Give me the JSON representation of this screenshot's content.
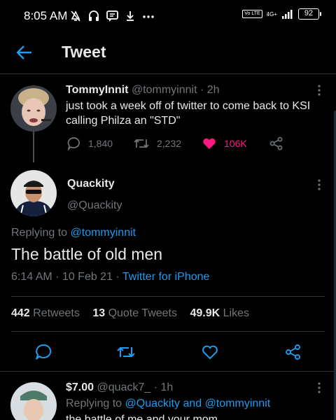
{
  "status_bar": {
    "time": "8:05 AM",
    "icons": [
      "alarm-off-icon",
      "headset-icon",
      "chat-bubble-icon",
      "download-icon",
      "more-dots-icon"
    ],
    "volte_label": "Vo LTE",
    "network_label": "4G+",
    "battery": "92"
  },
  "header": {
    "title": "Tweet",
    "accent": "#1d9bf0"
  },
  "tweet_parent": {
    "name": "TommyInnit",
    "handle": "@tommyinnit",
    "time": "· 2h",
    "text": "just took a week off of twitter to come back to KSI calling Philza an \"STD\"",
    "replies": "1,840",
    "retweets": "2,232",
    "likes": "106K",
    "like_color": "#f91880"
  },
  "tweet_main": {
    "name": "Quackity",
    "handle": "@Quackity",
    "replying_prefix": "Replying to",
    "replying_to": "@tommyinnit",
    "text": "The battle of old men",
    "time": "6:14 AM · 10 Feb 21 ·",
    "source": "Twitter for iPhone",
    "retweets_count": "442",
    "retweets_label": "Retweets",
    "quote_count": "13",
    "quote_label": "Quote Tweets",
    "likes_count": "49.9K",
    "likes_label": "Likes"
  },
  "tweet_reply": {
    "name": "$7.00",
    "handle": "@quack7_",
    "time": "· 1h",
    "replying_prefix": "Replying to",
    "replying_to_1": "@Quackity",
    "replying_and": "and",
    "replying_to_2": "@tommyinnit",
    "text": "the battle of me and your mom"
  }
}
